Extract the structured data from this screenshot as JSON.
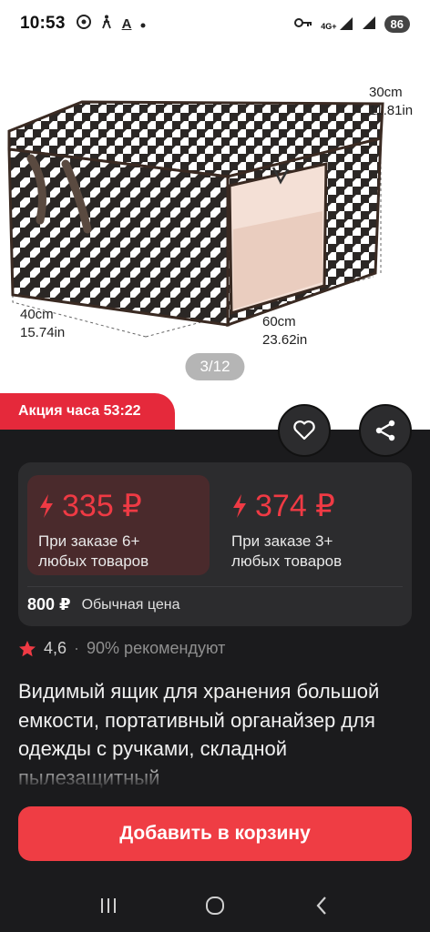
{
  "status_bar": {
    "time": "10:53",
    "network": "4G+",
    "battery": "86"
  },
  "gallery": {
    "pager": "3/12",
    "dimensions": {
      "height_cm": "30cm",
      "height_in": "11.81in",
      "depth_cm": "40cm",
      "depth_in": "15.74in",
      "width_cm": "60cm",
      "width_in": "23.62in"
    }
  },
  "promo": {
    "label": "Акция часа 53:22"
  },
  "pricing": {
    "tiers": [
      {
        "price": "335 ₽",
        "condition_line1": "При заказе 6+",
        "condition_line2": "любых товаров"
      },
      {
        "price": "374 ₽",
        "condition_line1": "При заказе 3+",
        "condition_line2": "любых товаров"
      }
    ],
    "regular_price": "800 ₽",
    "regular_label": "Обычная цена"
  },
  "rating": {
    "value": "4,6",
    "separator": "·",
    "recommend": "90% рекомендуют"
  },
  "product": {
    "title": "Видимый ящик для хранения большой емкости, портативный органайзер для одежды с ручками, складной пылезащитный"
  },
  "cta": {
    "label": "Добавить в корзину"
  },
  "colors": {
    "accent": "#ef3d44",
    "promo": "#e5293b",
    "background": "#1b1b1d",
    "card": "#2c2c2e"
  }
}
